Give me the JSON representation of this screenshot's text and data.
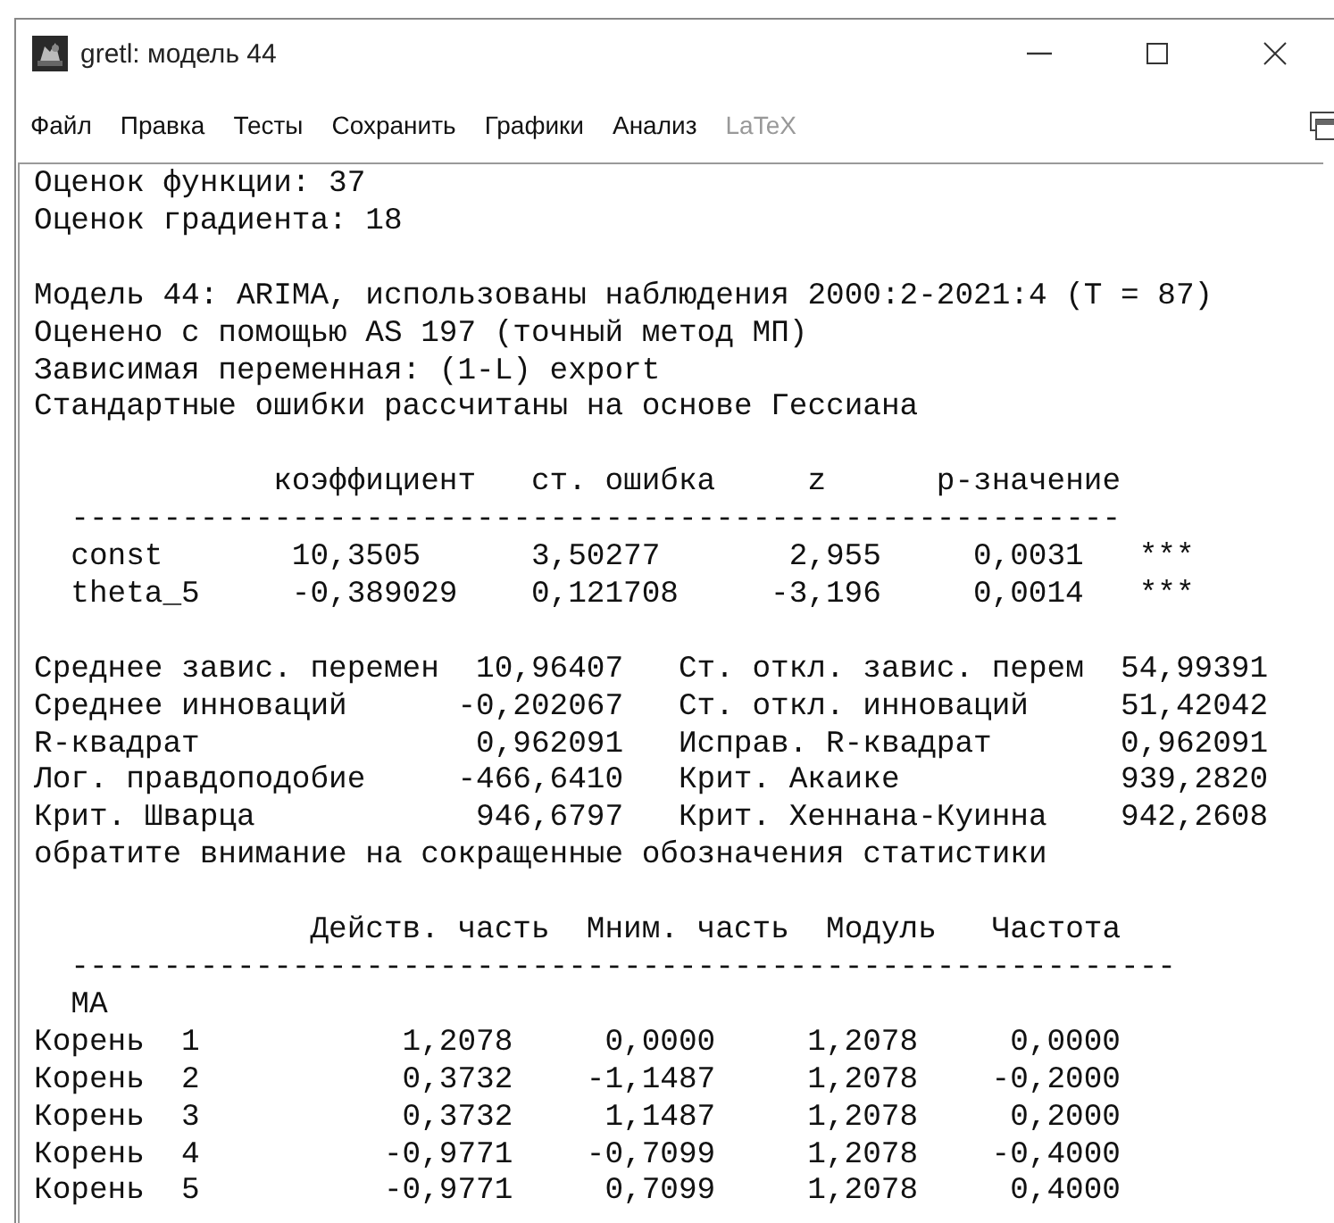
{
  "window": {
    "title": "gretl: модель 44"
  },
  "menu": [
    {
      "label": "Файл",
      "disabled": false
    },
    {
      "label": "Правка",
      "disabled": false
    },
    {
      "label": "Тесты",
      "disabled": false
    },
    {
      "label": "Сохранить",
      "disabled": false
    },
    {
      "label": "Графики",
      "disabled": false
    },
    {
      "label": "Анализ",
      "disabled": false
    },
    {
      "label": "LaTeX",
      "disabled": true
    }
  ],
  "output": {
    "iteration_lines": [
      "Оценок функции: 37",
      "Оценок градиента: 18"
    ],
    "model_lines": [
      "Модель 44: ARIMA, использованы наблюдения 2000:2-2021:4 (T = 87)",
      "Оценено с помощью AS 197 (точный метод МП)",
      "Зависимая переменная: (1-L) export",
      "Стандартные ошибки рассчитаны на основе Гессиана"
    ],
    "coefficients": {
      "columns": [
        "коэффициент",
        "ст. ошибка",
        "z",
        "p-значение"
      ],
      "rule": "---------------------------------------------------------",
      "rows": [
        {
          "name": "const",
          "values": [
            "10,3505",
            "3,50277",
            "2,955",
            "0,0031"
          ],
          "significance": "***"
        },
        {
          "name": "theta_5",
          "values": [
            "-0,389029",
            "0,121708",
            "-3,196",
            "0,0014"
          ],
          "significance": "***"
        }
      ]
    },
    "statistics": [
      {
        "label": "Среднее завис. перемен",
        "value": "10,96407",
        "label_2": "Ст. откл. завис. перем",
        "value_2": "54,99391"
      },
      {
        "label": "Среднее инноваций",
        "value": "-0,202067",
        "label_2": "Ст. откл. инноваций",
        "value_2": "51,42042"
      },
      {
        "label": "R-квадрат",
        "value": "0,962091",
        "label_2": "Исправ. R-квадрат",
        "value_2": "0,962091"
      },
      {
        "label": "Лог. правдоподобие",
        "value": "-466,6410",
        "label_2": "Крит. Акаике",
        "value_2": "939,2820"
      },
      {
        "label": "Крит. Шварца",
        "value": "946,6797",
        "label_2": "Крит. Хеннана-Куинна",
        "value_2": "942,2608"
      }
    ],
    "note": "обратите внимание на сокращенные обозначения статистики",
    "roots": {
      "columns": [
        "Действ. часть",
        "Мним. часть",
        "Модуль",
        "Частота"
      ],
      "rule": "------------------------------------------------------------",
      "group": "MA",
      "rows": [
        {
          "name": "Корень",
          "index": "1",
          "values": [
            "1,2078",
            "0,0000",
            "1,2078",
            "0,0000"
          ]
        },
        {
          "name": "Корень",
          "index": "2",
          "values": [
            "0,3732",
            "-1,1487",
            "1,2078",
            "-0,2000"
          ]
        },
        {
          "name": "Корень",
          "index": "3",
          "values": [
            "0,3732",
            "1,1487",
            "1,2078",
            "0,2000"
          ]
        },
        {
          "name": "Корень",
          "index": "4",
          "values": [
            "-0,9771",
            "-0,7099",
            "1,2078",
            "-0,4000"
          ]
        },
        {
          "name": "Корень",
          "index": "5",
          "values": [
            "-0,9771",
            "0,7099",
            "1,2078",
            "0,4000"
          ]
        }
      ]
    }
  }
}
